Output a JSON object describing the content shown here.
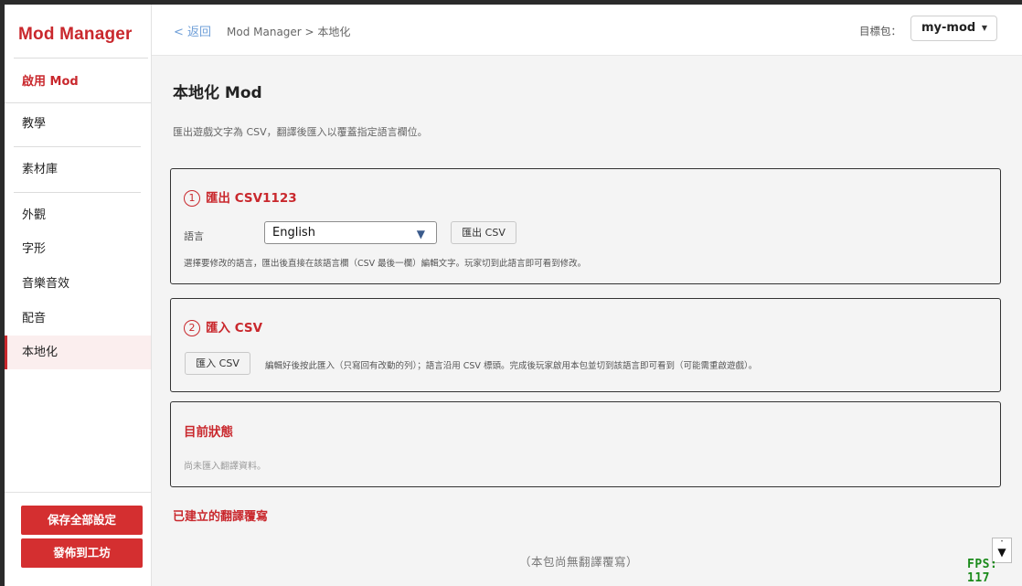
{
  "app": {
    "title": "Mod Manager"
  },
  "sidebar": {
    "enable_label": "啟用 Mod",
    "items": [
      {
        "label": "教學"
      },
      {
        "label": "素材庫"
      },
      {
        "label": "外觀"
      },
      {
        "label": "字形"
      },
      {
        "label": "音樂音效"
      },
      {
        "label": "配音"
      },
      {
        "label": "本地化"
      }
    ],
    "active_item": "本地化",
    "save_button": "保存全部設定",
    "publish_button": "發佈到工坊"
  },
  "header": {
    "back": "< 返回",
    "breadcrumb": "Mod Manager > 本地化",
    "target_label": "目標包：",
    "target_value": "my-mod"
  },
  "page": {
    "title": "本地化 Mod",
    "description": "匯出遊戲文字為 CSV，翻譯後匯入以覆蓋指定語言欄位。"
  },
  "export_card": {
    "number": "1",
    "title": "匯出 CSV1123",
    "language_label": "語言",
    "language_value": "English",
    "export_button": "匯出 CSV",
    "hint": "選擇要修改的語言，匯出後直接在該語言欄（CSV 最後一欄）編輯文字。玩家切到此語言即可看到修改。"
  },
  "import_card": {
    "number": "2",
    "title": "匯入 CSV",
    "import_button": "匯入 CSV",
    "hint": "編輯好後按此匯入（只寫回有改動的列）；語言沿用 CSV 標頭。完成後玩家啟用本包並切到該語言即可看到（可能需重啟遊戲）。"
  },
  "status_card": {
    "title": "目前狀態",
    "empty_text": "尚未匯入翻譯資料。"
  },
  "overrides": {
    "title": "已建立的翻譯覆寫",
    "empty_text": "（本包尚無翻譯覆寫）"
  },
  "overlay": {
    "fps": "FPS: 117"
  },
  "colors": {
    "accent": "#c9282d",
    "button_red": "#d42f30",
    "fps_green": "#1a8a1a"
  }
}
